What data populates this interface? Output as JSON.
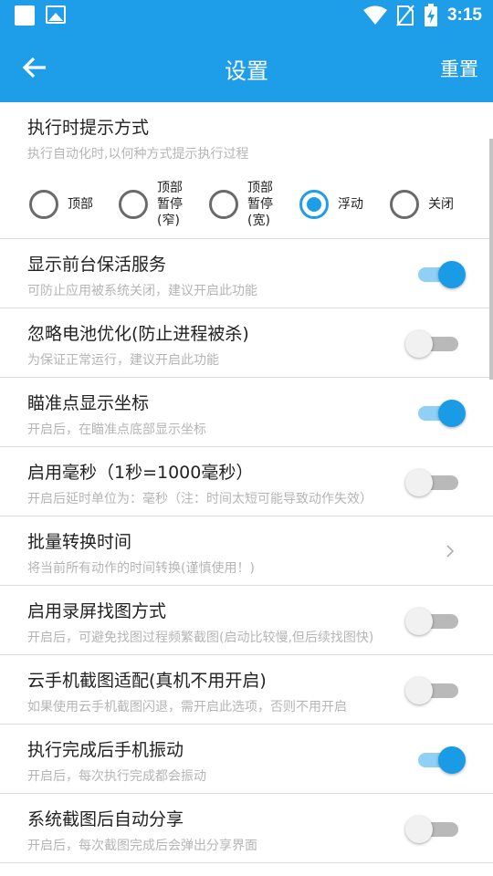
{
  "statusbar": {
    "time": "3:15"
  },
  "appbar": {
    "title": "设置",
    "reset": "重置"
  },
  "notify": {
    "title": "执行时提示方式",
    "subtitle": "执行自动化时,以何种方式提示执行过程",
    "options": [
      {
        "lines": [
          "顶部"
        ],
        "selected": false
      },
      {
        "lines": [
          "顶部",
          "暂停",
          "(窄)"
        ],
        "selected": false
      },
      {
        "lines": [
          "顶部",
          "暂停",
          "(宽)"
        ],
        "selected": false
      },
      {
        "lines": [
          "浮动"
        ],
        "selected": true
      },
      {
        "lines": [
          "关闭"
        ],
        "selected": false
      }
    ]
  },
  "settings": [
    {
      "title": "显示前台保活服务",
      "subtitle": "可防止应用被系统关闭，建议开启此功能",
      "control": "toggle",
      "on": true
    },
    {
      "title": "忽略电池优化(防止进程被杀)",
      "subtitle": "为保证正常运行，建议开启此功能",
      "control": "toggle",
      "on": false
    },
    {
      "title": "瞄准点显示坐标",
      "subtitle": "开启后，在瞄准点底部显示坐标",
      "control": "toggle",
      "on": true
    },
    {
      "title": "启用毫秒（1秒=1000毫秒）",
      "subtitle": "开启后延时单位为：毫秒（注：时间太短可能导致动作失效）",
      "control": "toggle",
      "on": false
    },
    {
      "title": "批量转换时间",
      "subtitle": "将当前所有动作的时间转换(谨慎使用！)",
      "control": "chevron",
      "on": false
    },
    {
      "title": "启用录屏找图方式",
      "subtitle": "开启后，可避免找图过程频繁截图(启动比较慢,但后续找图快)",
      "control": "toggle",
      "on": false
    },
    {
      "title": "云手机截图适配(真机不用开启)",
      "subtitle": "如果使用云手机截图闪退，需开启此选项，否则不用开启",
      "control": "toggle",
      "on": false
    },
    {
      "title": "执行完成后手机振动",
      "subtitle": "开启后，每次执行完成都会振动",
      "control": "toggle",
      "on": true
    },
    {
      "title": "系统截图后自动分享",
      "subtitle": "开启后，每次截图完成后会弹出分享界面",
      "control": "toggle",
      "on": false
    }
  ],
  "colors": {
    "primary": "#1e9ee8",
    "toggle_on_track": "#8fd0f4",
    "toggle_off_track": "#b9b9b9"
  }
}
